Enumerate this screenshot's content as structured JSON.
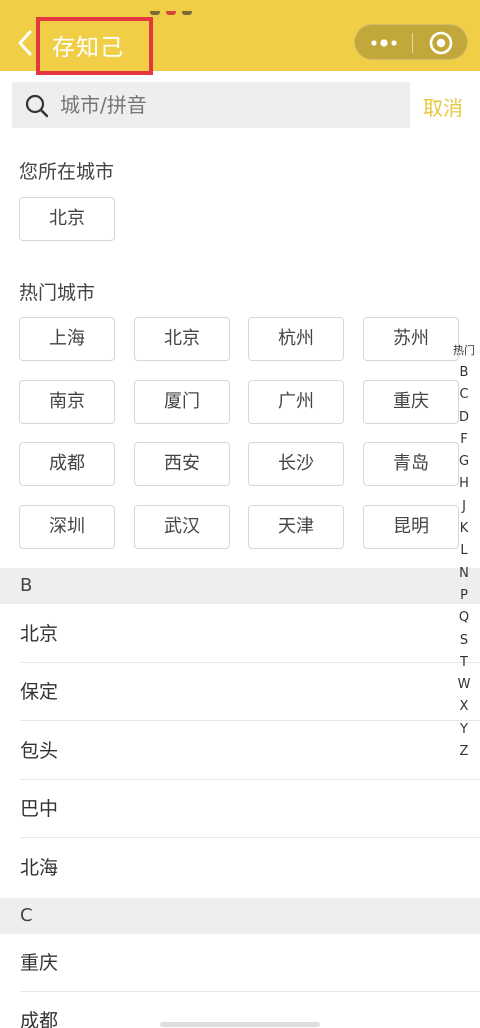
{
  "header": {
    "title": "存知己",
    "background": "#f0cf46",
    "highlight_color": "#e53740",
    "back_icon": "chevron-left-icon",
    "more_icon": "more-dots-icon",
    "close_icon": "target-close-icon"
  },
  "search": {
    "placeholder": "城市/拼音",
    "value": "",
    "cancel_label": "取消",
    "accent": "#e8c740"
  },
  "current_city": {
    "title": "您所在城市",
    "city": "北京"
  },
  "hot_cities": {
    "title": "热门城市",
    "cities": [
      "上海",
      "北京",
      "杭州",
      "苏州",
      "南京",
      "厦门",
      "广州",
      "重庆",
      "成都",
      "西安",
      "长沙",
      "青岛",
      "深圳",
      "武汉",
      "天津",
      "昆明"
    ]
  },
  "index_bar": [
    "热门",
    "B",
    "C",
    "D",
    "F",
    "G",
    "H",
    "J",
    "K",
    "L",
    "N",
    "P",
    "Q",
    "S",
    "T",
    "W",
    "X",
    "Y",
    "Z"
  ],
  "city_list": {
    "groups": [
      {
        "letter": "B",
        "cities": [
          "北京",
          "保定",
          "包头",
          "巴中",
          "北海"
        ]
      },
      {
        "letter": "C",
        "cities": [
          "重庆",
          "成都"
        ]
      }
    ]
  }
}
